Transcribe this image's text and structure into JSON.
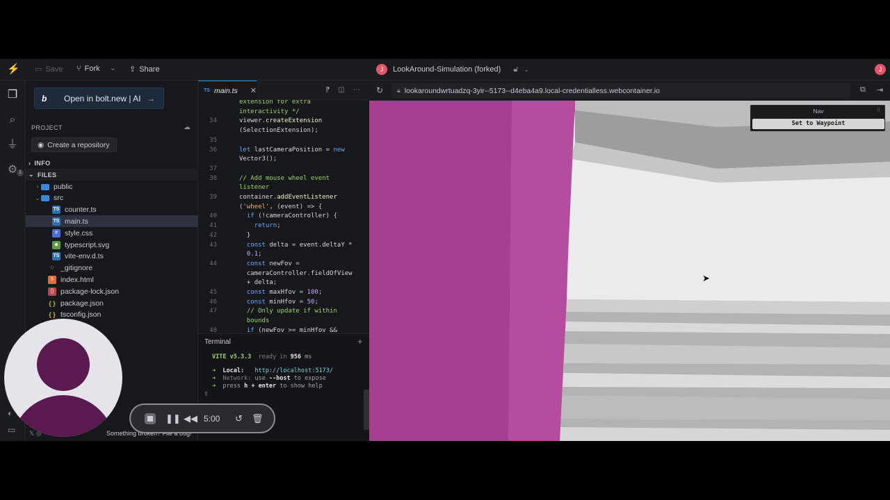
{
  "topbar": {
    "save": "Save",
    "fork": "Fork",
    "share": "Share",
    "project_title": "LookAround-Simulation (forked)",
    "avatar_initial": "J"
  },
  "explorer": {
    "open_bolt_label": "Open in bolt.new | AI",
    "project_label": "PROJECT",
    "create_repo": "Create a repository",
    "info_label": "INFO",
    "files_label": "FILES",
    "tree": [
      {
        "name": "public",
        "type": "folder"
      },
      {
        "name": "src",
        "type": "folder-open"
      },
      {
        "name": "counter.ts",
        "type": "ts"
      },
      {
        "name": "main.ts",
        "type": "ts"
      },
      {
        "name": "style.css",
        "type": "css"
      },
      {
        "name": "typescript.svg",
        "type": "svg"
      },
      {
        "name": "vite-env.d.ts",
        "type": "ts"
      },
      {
        "name": "_gitignore",
        "type": "git"
      },
      {
        "name": "index.html",
        "type": "html"
      },
      {
        "name": "package-lock.json",
        "type": "lock"
      },
      {
        "name": "package.json",
        "type": "json"
      },
      {
        "name": "tsconfig.json",
        "type": "json"
      }
    ],
    "bug_text": "Something broken? File a bug!"
  },
  "recorder": {
    "time": "5:00"
  },
  "editor": {
    "tab_label": "main.ts",
    "tab_lang": "TS",
    "lines": [
      {
        "n": "",
        "t": "extension for extra"
      },
      {
        "n": "",
        "t": "interactivity */"
      },
      {
        "n": "34",
        "t": "viewer.createExtension"
      },
      {
        "n": "",
        "t": "(SelectionExtension);"
      },
      {
        "n": "35",
        "t": ""
      },
      {
        "n": "36",
        "t": "let lastCameraPosition = new"
      },
      {
        "n": "",
        "t": "Vector3();"
      },
      {
        "n": "37",
        "t": ""
      },
      {
        "n": "38",
        "t": "// Add mouse wheel event"
      },
      {
        "n": "",
        "t": "listener"
      },
      {
        "n": "39",
        "t": "container.addEventListener"
      },
      {
        "n": "",
        "t": "('wheel', (event) => {"
      },
      {
        "n": "40",
        "t": "  if (!cameraController) {"
      },
      {
        "n": "41",
        "t": "    return;"
      },
      {
        "n": "42",
        "t": "  }"
      },
      {
        "n": "43",
        "t": "  const delta = event.deltaY *"
      },
      {
        "n": "",
        "t": "  0.1;"
      },
      {
        "n": "44",
        "t": "  const newFov ="
      },
      {
        "n": "",
        "t": "  cameraController.fieldOfView"
      },
      {
        "n": "",
        "t": "  + delta;"
      },
      {
        "n": "45",
        "t": "  const maxHfov = 100;"
      },
      {
        "n": "46",
        "t": "  const minHfov = 50;"
      },
      {
        "n": "47",
        "t": "  // Only update if within"
      },
      {
        "n": "",
        "t": "  bounds"
      },
      {
        "n": "48",
        "t": "  if (newFov >= minHfov &&"
      }
    ]
  },
  "terminal": {
    "title": "Terminal",
    "vite": "VITE v5.3.3",
    "ready": "ready in",
    "ms": "956",
    "ms_unit": "ms",
    "local_label": "Local:",
    "local_url": "http://localhost:5173/",
    "network_label": "Network:",
    "network_pre": "use",
    "network_flag": "--host",
    "network_post": "to expose",
    "press": "press",
    "press_keys": "h + enter",
    "press_post": "to show help"
  },
  "preview": {
    "url": "lookaroundwrtuadzq-3yir--5173--d4eba4a9.local-credentialless.webcontainer.io",
    "nav_title": "Nav",
    "nav_button": "Set to Waypoint"
  },
  "colors": {
    "accent": "#2f9bff",
    "magenta_wall": "#b0489a"
  }
}
